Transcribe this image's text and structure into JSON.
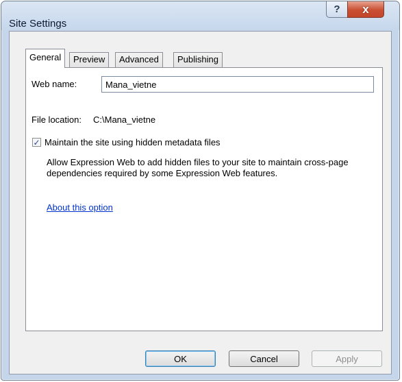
{
  "window": {
    "title": "Site Settings",
    "help_glyph": "?",
    "close_glyph": "x"
  },
  "tabs": [
    {
      "label": "General",
      "active": true
    },
    {
      "label": "Preview",
      "active": false
    },
    {
      "label": "Advanced",
      "active": false
    },
    {
      "label": "Publishing",
      "active": false
    }
  ],
  "general": {
    "web_name_label": "Web name:",
    "web_name_value": "Mana_vietne",
    "file_location_label": "File location:",
    "file_location_value": "C:\\Mana_vietne",
    "metadata_checkbox": {
      "label": "Maintain the site using hidden metadata files",
      "checked": true,
      "check_glyph": "✓"
    },
    "description": "Allow Expression Web to add hidden files to your site to maintain cross-page dependencies required by some Expression Web features.",
    "about_link": "About this option"
  },
  "buttons": {
    "ok": "OK",
    "cancel": "Cancel",
    "apply": "Apply"
  },
  "colors": {
    "link": "#0033cc",
    "close_button": "#c94f33",
    "window_frame": "#c5d6ea"
  }
}
